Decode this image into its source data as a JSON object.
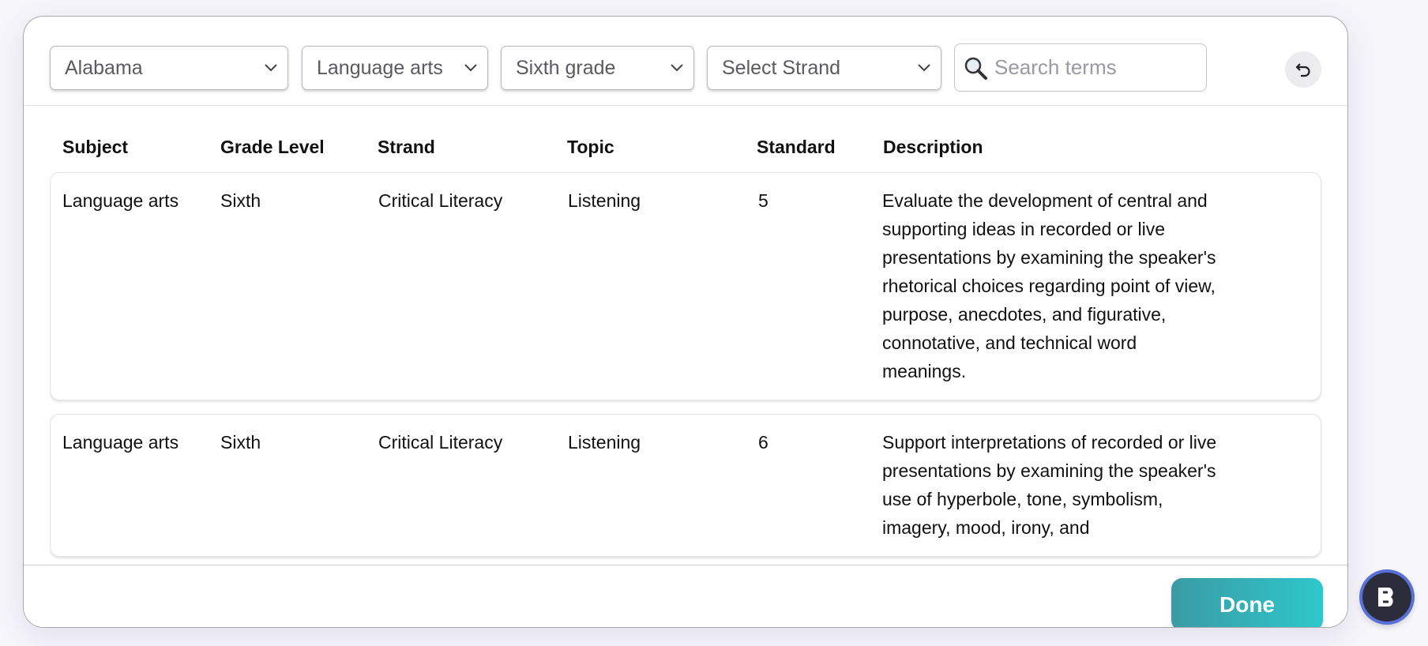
{
  "filters": {
    "state": "Alabama",
    "subject": "Language arts",
    "grade": "Sixth grade",
    "strand": "Select Strand",
    "search_placeholder": "Search terms"
  },
  "table": {
    "headers": [
      "Subject",
      "Grade Level",
      "Strand",
      "Topic",
      "Standard",
      "Description"
    ],
    "rows": [
      {
        "subject": "Language arts",
        "grade": "Sixth",
        "strand": "Critical Literacy",
        "topic": "Listening",
        "standard": "5",
        "description": "Evaluate the development of central and supporting ideas in recorded or live presentations by examining the speaker's rhetorical choices regarding point of view, purpose, anecdotes, and figurative, connotative, and technical word meanings."
      },
      {
        "subject": "Language arts",
        "grade": "Sixth",
        "strand": "Critical Literacy",
        "topic": "Listening",
        "standard": "6",
        "description": "Support interpretations of recorded or live presentations by examining the speaker's use of hyperbole, tone, symbolism, imagery, mood, irony, and"
      }
    ]
  },
  "footer": {
    "done_label": "Done"
  },
  "icons": {
    "search": "magnifier-icon",
    "reset": "undo-icon",
    "badge": "bookmarklet-logo-icon",
    "chevron": "chevron-down-icon"
  },
  "colors": {
    "done_start": "#3a9ba3",
    "done_end": "#2ec7cb",
    "badge_ring": "#5870d8"
  }
}
